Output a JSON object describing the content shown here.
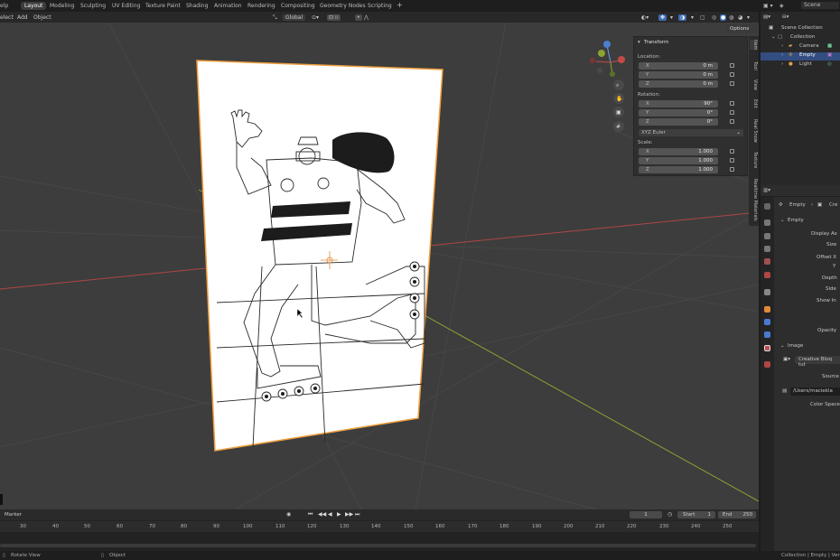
{
  "menubar": {
    "help": "elp",
    "tabs": [
      "Layout",
      "Modeling",
      "Sculpting",
      "UV Editing",
      "Texture Paint",
      "Shading",
      "Animation",
      "Rendering",
      "Compositing",
      "Geometry Nodes",
      "Scripting"
    ],
    "add_tab": "+",
    "scene_label": "Scene"
  },
  "header": {
    "select": "elect",
    "add": "Add",
    "object": "Object",
    "orientation": "Global",
    "options": "Options"
  },
  "transform": {
    "title": "Transform",
    "location_label": "Location:",
    "location": [
      {
        "k": "X",
        "v": "0 m"
      },
      {
        "k": "Y",
        "v": "0 m"
      },
      {
        "k": "Z",
        "v": "0 m"
      }
    ],
    "rotation_label": "Rotation:",
    "rotation": [
      {
        "k": "X",
        "v": "90°"
      },
      {
        "k": "Y",
        "v": "0°"
      },
      {
        "k": "Z",
        "v": "0°"
      }
    ],
    "rotation_mode": "XYZ Euler",
    "scale_label": "Scale:",
    "scale": [
      {
        "k": "X",
        "v": "1.000"
      },
      {
        "k": "Y",
        "v": "1.000"
      },
      {
        "k": "Z",
        "v": "1.000"
      }
    ]
  },
  "sidetabs": [
    "Item",
    "Tool",
    "View",
    "Edit",
    "Real Snow",
    "Texture",
    "Realtime Materials"
  ],
  "outliner": {
    "scene_collection": "Scene Collection",
    "collection": "Collection",
    "items": [
      "Camera",
      "Empty",
      "Light"
    ]
  },
  "properties": {
    "object_name": "Empty",
    "data_name": "Cre",
    "section_empty": "Empty",
    "display_as": "Display As",
    "size": "Size",
    "offset_x": "Offset X",
    "offset_y": "Y",
    "depth": "Depth",
    "side": "Side",
    "show_in": "Show In",
    "opacity": "Opacity",
    "section_image": "Image",
    "image_name": "Creative Bloq tut",
    "source": "Source",
    "filepath": "/Users/maciekla",
    "color_space": "Color Space"
  },
  "timeline": {
    "marker": "Marker",
    "current_frame": "1",
    "start_label": "Start",
    "start": "1",
    "end_label": "End",
    "end": "250",
    "ticks": [
      "30",
      "40",
      "50",
      "60",
      "70",
      "80",
      "90",
      "100",
      "110",
      "120",
      "130",
      "140",
      "150",
      "160",
      "170",
      "180",
      "190",
      "200",
      "210",
      "220",
      "230",
      "240",
      "250"
    ]
  },
  "statusbar": {
    "rotate_view": "Rotate View",
    "object": "Object",
    "right": "Collection | Empty | Ver"
  },
  "colors": {
    "viewport_bg": "#3d3d3d",
    "selection_orange": "#f0a040",
    "x_axis": "#c44a4a",
    "y_axis": "#8aa532",
    "active_tab": "#3d3d3d",
    "outliner_highlight": "#334d80"
  }
}
